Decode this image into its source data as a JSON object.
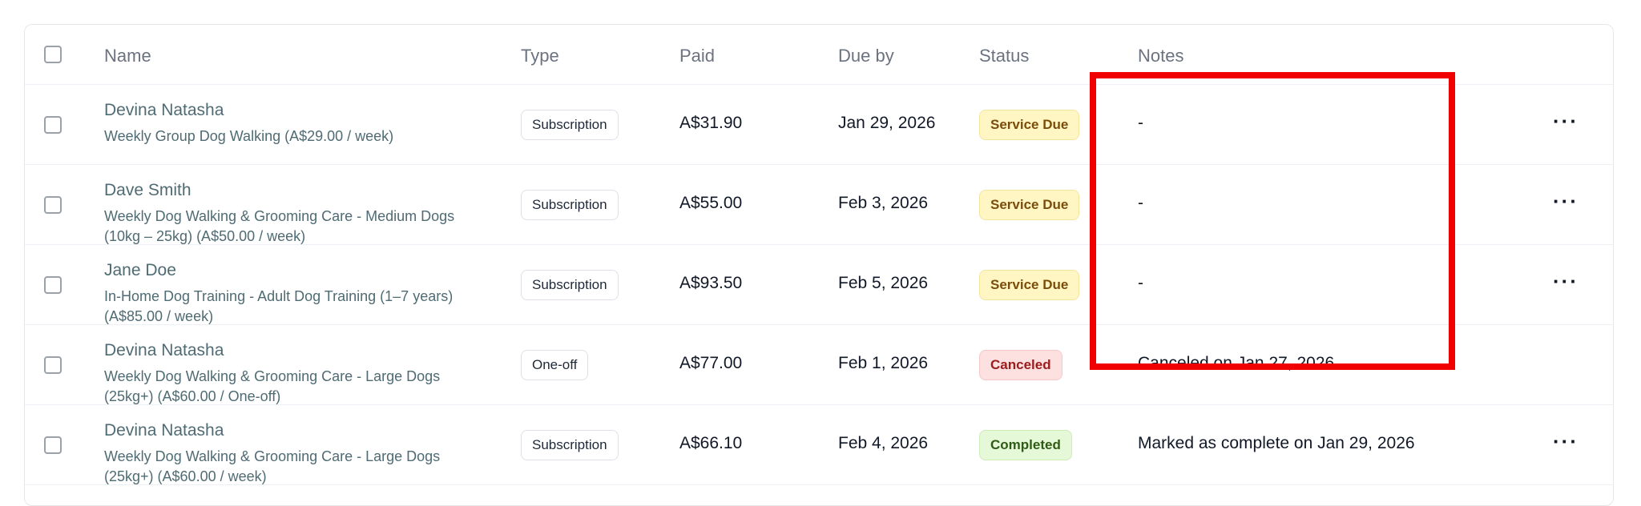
{
  "columns": {
    "name": "Name",
    "type": "Type",
    "paid": "Paid",
    "due_by": "Due by",
    "status": "Status",
    "notes": "Notes"
  },
  "rows": [
    {
      "name": "Devina Natasha",
      "plan": "Weekly Group Dog Walking (A$29.00 / week)",
      "type": "Subscription",
      "paid": "A$31.90",
      "due_by": "Jan 29, 2026",
      "status": "Service Due",
      "notes": "-",
      "more": "···"
    },
    {
      "name": "Dave Smith",
      "plan": "Weekly Dog Walking & Grooming Care - Medium Dogs (10kg – 25kg) (A$50.00 / week)",
      "type": "Subscription",
      "paid": "A$55.00",
      "due_by": "Feb 3, 2026",
      "status": "Service Due",
      "notes": "-",
      "more": "···"
    },
    {
      "name": "Jane Doe",
      "plan": "In-Home Dog Training - Adult Dog Training (1–7 years) (A$85.00 / week)",
      "type": "Subscription",
      "paid": "A$93.50",
      "due_by": "Feb 5, 2026",
      "status": "Service Due",
      "notes": "-",
      "more": "···"
    },
    {
      "name": "Devina Natasha",
      "plan": "Weekly Dog Walking & Grooming Care - Large Dogs (25kg+) (A$60.00 / One-off)",
      "type": "One-off",
      "paid": "A$77.00",
      "due_by": "Feb 1, 2026",
      "status": "Canceled",
      "notes": "Canceled on Jan 27, 2026"
    },
    {
      "name": "Devina Natasha",
      "plan": "Weekly Dog Walking & Grooming Care - Large Dogs (25kg+) (A$60.00 / week)",
      "type": "Subscription",
      "paid": "A$66.10",
      "due_by": "Feb 4, 2026",
      "status": "Completed",
      "notes": "Marked as complete on Jan 29, 2026",
      "more": "···"
    }
  ],
  "colors": {
    "highlight": "#f00000",
    "service_due": "#fff6c4",
    "canceled": "#fde0e0",
    "completed": "#e5f8d7"
  }
}
